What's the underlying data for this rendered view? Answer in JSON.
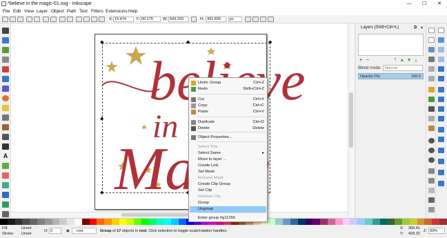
{
  "window": {
    "title": "*believe in the magic-01.svg - Inkscape",
    "min_icon": "—",
    "max_icon": "☐",
    "close_icon": "✕"
  },
  "menus": [
    "File",
    "Edit",
    "View",
    "Layer",
    "Object",
    "Path",
    "Text",
    "Filters",
    "Extensions",
    "Help"
  ],
  "controls": {
    "x_label": "X:",
    "x_value": "19.474",
    "y_label": "Y:",
    "y_value": "50.170",
    "w_label": "W:",
    "w_value": "543.203",
    "h_label": "H:",
    "h_value": "491.830",
    "unit": "px"
  },
  "canvas_art": {
    "line1": "believe",
    "line2": "in the",
    "line3": "Magic",
    "art_color": "#b0313a",
    "star_color": "#c9a74d"
  },
  "layers_panel": {
    "title": "Layers (Shift+Ctrl+L)",
    "blend_label": "Blend mode:",
    "blend_value": "Normal",
    "opacity_label": "Opacity (%)",
    "opacity_value": "100.0"
  },
  "context_menu": {
    "items": [
      {
        "label": "Undo: Group",
        "shortcut": "Ctrl+Z",
        "disabled": false,
        "icon": "undo-icon"
      },
      {
        "label": "Redo",
        "shortcut": "Shift+Ctrl+Z",
        "disabled": false,
        "icon": "redo-icon"
      },
      {
        "label": "Cut",
        "shortcut": "Ctrl+X",
        "disabled": false,
        "icon": "cut-icon"
      },
      {
        "label": "Copy",
        "shortcut": "Ctrl+C",
        "disabled": false,
        "icon": "copy-icon"
      },
      {
        "label": "Paste",
        "shortcut": "Ctrl+V",
        "disabled": false,
        "icon": "paste-icon"
      },
      {
        "label": "Duplicate",
        "shortcut": "Ctrl+D",
        "disabled": false,
        "icon": "duplicate-icon"
      },
      {
        "label": "Delete",
        "shortcut": "Delete",
        "disabled": false,
        "icon": "delete-icon"
      },
      {
        "label": "Object Properties...",
        "shortcut": "",
        "disabled": false,
        "icon": "properties-icon"
      },
      {
        "label": "Select This",
        "shortcut": "",
        "disabled": true,
        "icon": ""
      },
      {
        "label": "Select Same",
        "shortcut": "▸",
        "disabled": false,
        "icon": ""
      },
      {
        "label": "Move to layer ...",
        "shortcut": "",
        "disabled": false,
        "icon": ""
      },
      {
        "label": "Create Link",
        "shortcut": "",
        "disabled": false,
        "icon": ""
      },
      {
        "label": "Set Mask",
        "shortcut": "",
        "disabled": false,
        "icon": ""
      },
      {
        "label": "Release Mask",
        "shortcut": "",
        "disabled": true,
        "icon": ""
      },
      {
        "label": "Create Clip Group",
        "shortcut": "",
        "disabled": false,
        "icon": ""
      },
      {
        "label": "Set Clip",
        "shortcut": "",
        "disabled": false,
        "icon": ""
      },
      {
        "label": "Release Clip",
        "shortcut": "",
        "disabled": true,
        "icon": ""
      },
      {
        "label": "Group",
        "shortcut": "",
        "disabled": false,
        "icon": ""
      },
      {
        "label": "Ungroup",
        "shortcut": "",
        "disabled": false,
        "icon": "",
        "highlighted": true
      },
      {
        "label": "Enter group #g11266",
        "shortcut": "",
        "disabled": false,
        "icon": ""
      }
    ]
  },
  "status": {
    "fill_label": "Fill:",
    "fill_value": "Unset",
    "stroke_label": "Stroke:",
    "stroke_value": "Unset",
    "opacity_label": "O:",
    "opacity_value": "0",
    "layer_value": "root",
    "message": "Group of 17 objects in root. Click selection to toggle scale/rotation handles.",
    "x_label": "X:",
    "x_value": "309.41",
    "y_label": "Y:",
    "y_value": "429.32",
    "z_label": "Z:",
    "zoom": "93%"
  },
  "palette_colors": [
    "#000000",
    "#1a1a1a",
    "#333333",
    "#4d4d4d",
    "#666666",
    "#808080",
    "#999999",
    "#b3b3b3",
    "#cccccc",
    "#e6e6e6",
    "#ffffff",
    "#800000",
    "#ff0000",
    "#ff6600",
    "#ff9900",
    "#ffcc00",
    "#ffff00",
    "#ccff00",
    "#66ff00",
    "#00ff00",
    "#00ff66",
    "#00ffcc",
    "#00ffff",
    "#00ccff",
    "#0066ff",
    "#0000ff",
    "#6600ff",
    "#cc00ff",
    "#ff00ff",
    "#ff0099",
    "#ff3366",
    "#993300",
    "#996633",
    "#cc9966",
    "#ffcc99",
    "#ffffcc",
    "#ccffcc",
    "#99cccc",
    "#6699cc",
    "#336699",
    "#003366",
    "#330066",
    "#660066",
    "#993366",
    "#cc6699",
    "#ff99cc",
    "#ffccff",
    "#ccccff",
    "#99ccff",
    "#66cccc",
    "#339999",
    "#006666",
    "#336633",
    "#669933",
    "#99cc33",
    "#cccc33",
    "#cc9933",
    "#cc6633",
    "#cc3333",
    "#993333"
  ]
}
